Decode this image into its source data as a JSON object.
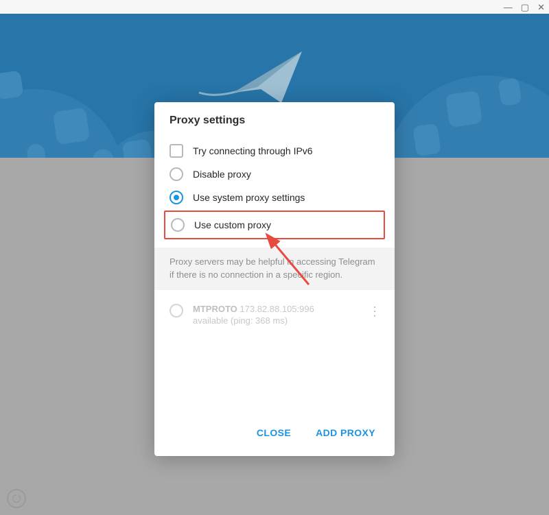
{
  "modal": {
    "title": "Proxy settings",
    "options": {
      "ipv6": "Try connecting through IPv6",
      "disable": "Disable proxy",
      "system": "Use system proxy settings",
      "custom": "Use custom proxy"
    },
    "hint": "Proxy servers may be helpful in accessing Telegram if there is no connection in a specific region.",
    "proxy": {
      "type": "MTPROTO",
      "addr": "173.82.88.105:996",
      "status": "available (ping: 368 ms)"
    },
    "actions": {
      "close": "CLOSE",
      "add": "ADD PROXY"
    }
  }
}
